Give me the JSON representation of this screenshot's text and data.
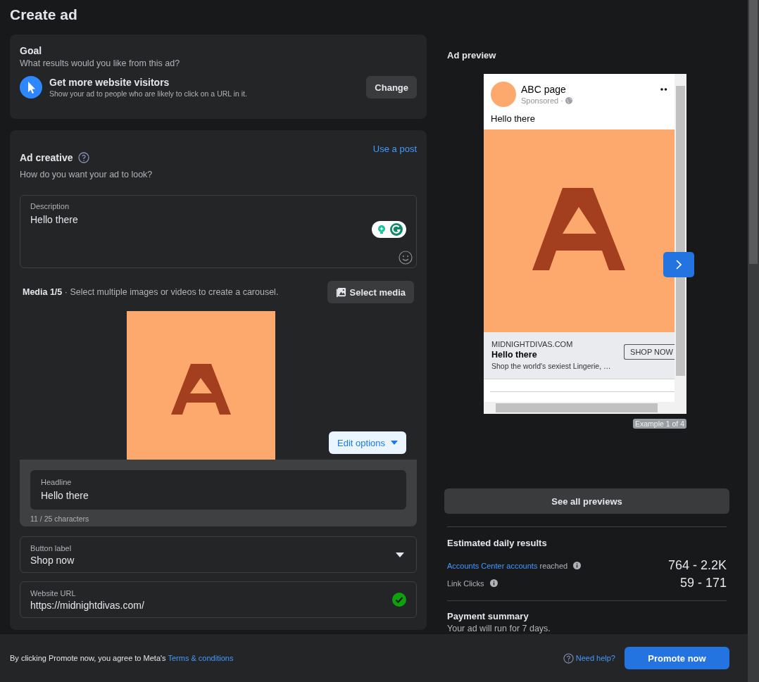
{
  "page": {
    "title": "Create ad"
  },
  "goal": {
    "title": "Goal",
    "subtitle": "What results would you like from this ad?",
    "objective": "Get more website visitors",
    "objective_description": "Show your ad to people who are likely to click on a URL in it.",
    "change_button": "Change"
  },
  "ad_creative": {
    "title": "Ad creative",
    "link": "Use a post",
    "subtitle": "How do you want your ad to look?",
    "description": {
      "label": "Description",
      "value": "Hello there"
    },
    "media": {
      "count": "Media 1/5",
      "hint": " · Select multiple images or videos to create a carousel.",
      "select_button": "Select media",
      "edit_button": "Edit options"
    },
    "headline": {
      "label": "Headline",
      "value": "Hello there",
      "counter": "11 / 25 characters"
    },
    "button_label": {
      "label": "Button label",
      "value": "Shop now"
    },
    "website_url": {
      "label": "Website URL",
      "value": "https://midnightdivas.com/",
      "valid": true
    }
  },
  "preview": {
    "title": "Ad preview",
    "page_name": "ABC page",
    "sponsored": "Sponsored ·",
    "text": "Hello there",
    "domain": "MIDNIGHTDIVAS.COM",
    "headline": "Hello there",
    "description": "Shop the world's sexiest Lingerie, …",
    "cta": "SHOP NOW",
    "example": "Example 1 of 4",
    "see_all": "See all previews"
  },
  "estimates": {
    "title": "Estimated daily results",
    "rows": [
      {
        "link": "Accounts Center accounts",
        "label": "reached",
        "value": "764 - 2.2K"
      },
      {
        "label": "Link Clicks",
        "value": "59 - 171"
      }
    ]
  },
  "payment": {
    "title": "Payment summary",
    "text": "Your ad will run for 7 days."
  },
  "footer": {
    "consent": "By clicking Promote now, you agree to Meta's",
    "terms": "Terms & conditions",
    "help": "Need help?",
    "promote_button": "Promote now"
  }
}
